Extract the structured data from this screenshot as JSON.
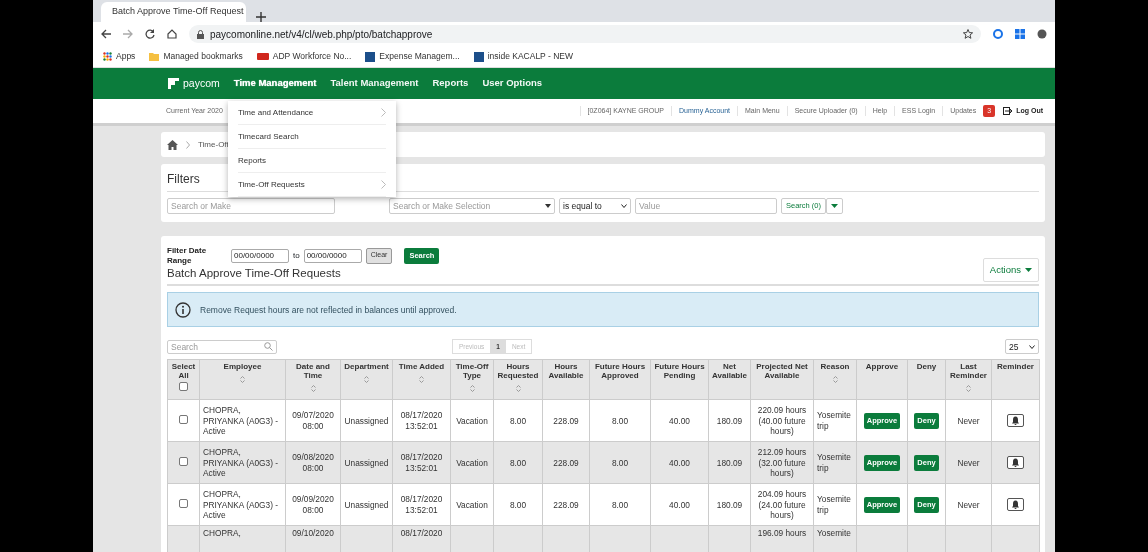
{
  "browser": {
    "tab_title": "Batch Approve Time-Off Request",
    "url": "paycomonline.net/v4/cl/web.php/pto/batchapprove",
    "bookmarks": [
      {
        "label": "Apps",
        "kind": "apps"
      },
      {
        "label": "Managed bookmarks",
        "kind": "folder"
      },
      {
        "label": "ADP Workforce No...",
        "kind": "adp"
      },
      {
        "label": "Expense Managem...",
        "kind": "ka"
      },
      {
        "label": "inside KACALP - NEW",
        "kind": "ka"
      }
    ]
  },
  "nav": {
    "logo": "paycom",
    "items": [
      {
        "label": "Time Management",
        "expanded": true
      },
      {
        "label": "Talent Management",
        "expanded": false
      },
      {
        "label": "Reports",
        "expanded": false
      },
      {
        "label": "User Options",
        "expanded": false
      }
    ]
  },
  "dropdown": {
    "items": [
      {
        "label": "Time and Attendance",
        "submenu": true
      },
      {
        "label": "Timecard Search",
        "submenu": false
      },
      {
        "label": "Reports",
        "submenu": false
      },
      {
        "label": "Time-Off Requests",
        "submenu": true
      }
    ]
  },
  "subheader": {
    "current_year": "Current Year 2020",
    "links": [
      {
        "label": "[0Z064] KAYNE GROUP",
        "kind": "plain"
      },
      {
        "label": "Dummy Account",
        "kind": "highlight"
      },
      {
        "label": "Main Menu",
        "kind": "plain"
      },
      {
        "label": "Secure Uploader (0)",
        "kind": "plain"
      },
      {
        "label": "Help",
        "kind": "plain"
      },
      {
        "label": "ESS Login",
        "kind": "plain"
      },
      {
        "label": "Updates",
        "kind": "plain"
      }
    ],
    "updates_badge": "3",
    "logout": "Log Out"
  },
  "breadcrumb": {
    "item": "Time-Off"
  },
  "filters": {
    "title": "Filters",
    "field_placeholder": "Search or Make",
    "select_placeholder": "Search or Make Selection",
    "operator": "is equal to",
    "value_placeholder": "Value",
    "search_button": "Search (0)"
  },
  "date_range": {
    "label": "Filter Date Range",
    "from": "00/00/0000",
    "to_label": "to",
    "to": "00/00/0000",
    "clear": "Clear",
    "search": "Search"
  },
  "section": {
    "title": "Batch Approve Time-Off Requests",
    "actions": "Actions",
    "info": "Remove Request hours are not reflected in balances until approved."
  },
  "table_tools": {
    "search_placeholder": "Search",
    "previous": "Previous",
    "page": "1",
    "next": "Next",
    "page_size": "25"
  },
  "table": {
    "select_all_checked": false,
    "columns": [
      {
        "label": "Select All",
        "sortable": false
      },
      {
        "label": "Employee",
        "sortable": true
      },
      {
        "label": "Date and Time",
        "sortable": true
      },
      {
        "label": "Department",
        "sortable": true
      },
      {
        "label": "Time Added",
        "sortable": true
      },
      {
        "label": "Time-Off Type",
        "sortable": true
      },
      {
        "label": "Hours Requested",
        "sortable": true
      },
      {
        "label": "Hours Available",
        "sortable": false
      },
      {
        "label": "Future Hours Approved",
        "sortable": false
      },
      {
        "label": "Future Hours Pending",
        "sortable": false
      },
      {
        "label": "Net Available",
        "sortable": false
      },
      {
        "label": "Projected Net Available",
        "sortable": false
      },
      {
        "label": "Reason",
        "sortable": true
      },
      {
        "label": "Approve",
        "sortable": false
      },
      {
        "label": "Deny",
        "sortable": false
      },
      {
        "label": "Last Reminder",
        "sortable": true
      },
      {
        "label": "Reminder",
        "sortable": false
      }
    ],
    "rows": [
      {
        "checked": false,
        "employee": "CHOPRA, PRIYANKA (A0G3) - Active",
        "date": "09/07/2020 08:00",
        "department": "Unassigned",
        "time_added": "08/17/2020 13:52:01",
        "type": "Vacation",
        "hours_requested": "8.00",
        "hours_available": "228.09",
        "future_approved": "8.00",
        "future_pending": "40.00",
        "net_available": "180.09",
        "projected": "220.09 hours (40.00 future hours)",
        "reason": "Yosemite trip",
        "approve": "Approve",
        "deny": "Deny",
        "last_reminder": "Never"
      },
      {
        "checked": false,
        "employee": "CHOPRA, PRIYANKA (A0G3) - Active",
        "date": "09/08/2020 08:00",
        "department": "Unassigned",
        "time_added": "08/17/2020 13:52:01",
        "type": "Vacation",
        "hours_requested": "8.00",
        "hours_available": "228.09",
        "future_approved": "8.00",
        "future_pending": "40.00",
        "net_available": "180.09",
        "projected": "212.09 hours (32.00 future hours)",
        "reason": "Yosemite trip",
        "approve": "Approve",
        "deny": "Deny",
        "last_reminder": "Never"
      },
      {
        "checked": false,
        "employee": "CHOPRA, PRIYANKA (A0G3) - Active",
        "date": "09/09/2020 08:00",
        "department": "Unassigned",
        "time_added": "08/17/2020 13:52:01",
        "type": "Vacation",
        "hours_requested": "8.00",
        "hours_available": "228.09",
        "future_approved": "8.00",
        "future_pending": "40.00",
        "net_available": "180.09",
        "projected": "204.09 hours (24.00 future hours)",
        "reason": "Yosemite trip",
        "approve": "Approve",
        "deny": "Deny",
        "last_reminder": "Never"
      },
      {
        "partial": true,
        "employee": "CHOPRA,",
        "date": "09/10/2020",
        "time_added": "08/17/2020",
        "projected": "196.09 hours",
        "reason": "Yosemite"
      }
    ]
  }
}
